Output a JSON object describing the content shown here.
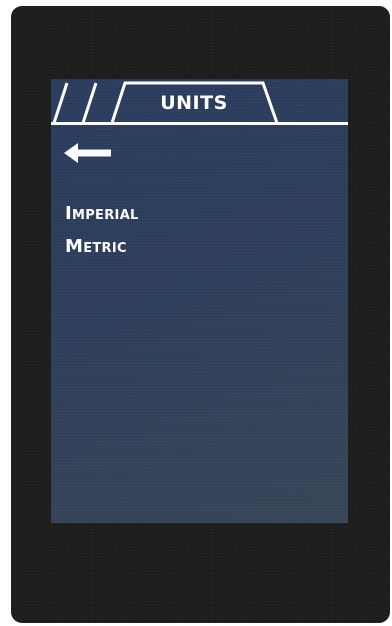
{
  "header": {
    "title": "UNITS"
  },
  "nav": {
    "back_icon": "left-arrow-icon"
  },
  "menu": {
    "items": [
      {
        "label": "Imperial"
      },
      {
        "label": "Metric"
      }
    ]
  },
  "colors": {
    "device_body": "#1d1d1c",
    "screen_background": "#2b3d5c",
    "foreground": "#ffffff"
  }
}
